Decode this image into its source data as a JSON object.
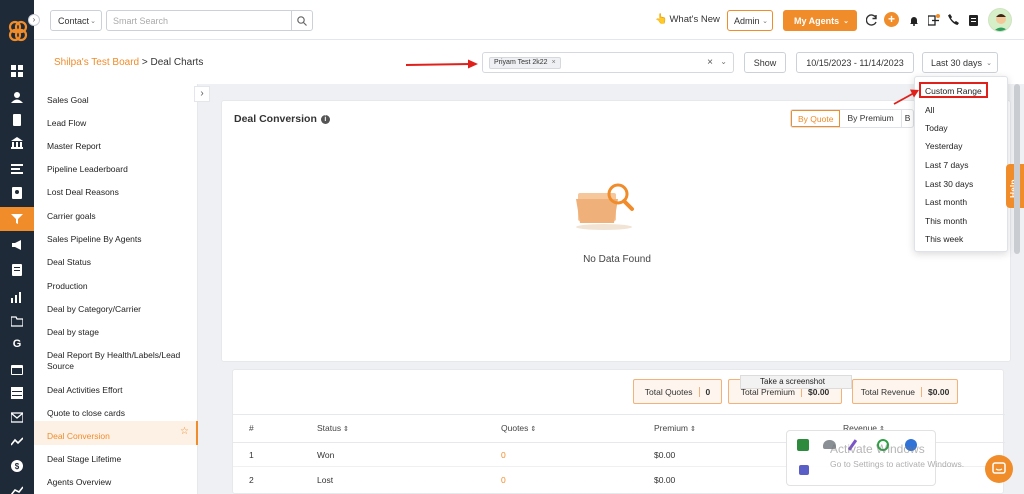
{
  "header": {
    "contact_select": "Contact",
    "search_placeholder": "Smart Search",
    "whats_new": "What's New",
    "admin_select": "Admin",
    "my_agents_button": "My Agents"
  },
  "page": {
    "breadcrumb_link": "Shilpa's Test Board",
    "breadcrumb_sep": ">",
    "breadcrumb_current": "Deal Charts",
    "filter_tag": "Priyam Test 2k22",
    "show_button": "Show",
    "date_range": "10/15/2023 - 11/14/2023",
    "period_select": "Last 30 days"
  },
  "sidebar": {
    "items": [
      {
        "label": "Sales Goal"
      },
      {
        "label": "Lead Flow"
      },
      {
        "label": "Master Report"
      },
      {
        "label": "Pipeline Leaderboard"
      },
      {
        "label": "Lost Deal Reasons"
      },
      {
        "label": "Carrier goals"
      },
      {
        "label": "Sales Pipeline By Agents"
      },
      {
        "label": "Deal Status"
      },
      {
        "label": "Production"
      },
      {
        "label": "Deal by Category/Carrier"
      },
      {
        "label": "Deal by stage"
      },
      {
        "label": "Deal Report By Health/Labels/Lead Source"
      },
      {
        "label": "Deal Activities Effort"
      },
      {
        "label": "Quote to close cards"
      },
      {
        "label": "Deal Conversion"
      },
      {
        "label": "Deal Stage Lifetime"
      },
      {
        "label": "Agents Overview"
      }
    ],
    "active_index": 14
  },
  "chart_card": {
    "title": "Deal Conversion",
    "tabs": [
      "By Quote",
      "By Premium",
      "B"
    ],
    "empty_text": "No Data Found"
  },
  "chart_data": {
    "type": "table",
    "columns": [
      "#",
      "Status",
      "Quotes",
      "Premium",
      "Revenue"
    ],
    "rows": [
      {
        "num": "1",
        "status": "Won",
        "quotes": "0",
        "premium": "$0.00"
      },
      {
        "num": "2",
        "status": "Lost",
        "quotes": "0",
        "premium": "$0.00"
      }
    ]
  },
  "summary": {
    "total_quotes_label": "Total Quotes",
    "total_quotes_value": "0",
    "total_premium_label": "Total Premium",
    "total_premium_value": "$0.00",
    "total_revenue_label": "Total Revenue",
    "total_revenue_value": "$0.00"
  },
  "dropdown": {
    "options": [
      "Custom Range",
      "All",
      "Today",
      "Yesterday",
      "Last 7 days",
      "Last 30 days",
      "Last month",
      "This month",
      "This week"
    ]
  },
  "tooltip": "Take a screenshot",
  "help_tab": "Help",
  "watermark": {
    "line1": "Activate Windows",
    "line2": "Go to Settings to activate Windows."
  },
  "colors": {
    "accent": "#f08c2a",
    "rail": "#1f2a38",
    "annotation": "#e0201b"
  }
}
